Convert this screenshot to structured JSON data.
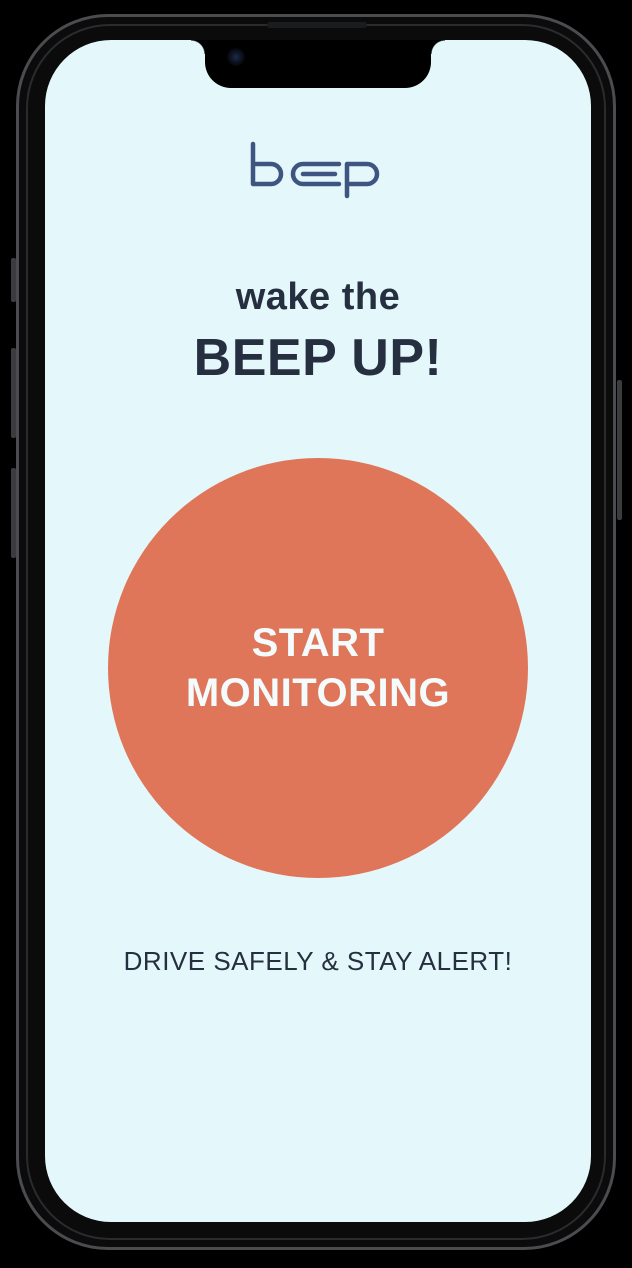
{
  "app": {
    "logo_name": "bep-logo",
    "brand_color": "#3d5580"
  },
  "hero": {
    "line1": "wake the",
    "line2": "BEEP UP!"
  },
  "start_button": {
    "line1": "START",
    "line2": "MONITORING",
    "color": "#df7659"
  },
  "footer": {
    "tagline": "DRIVE SAFELY & STAY ALERT!"
  },
  "theme": {
    "background": "#e4f8fb",
    "text": "#262f3f"
  }
}
